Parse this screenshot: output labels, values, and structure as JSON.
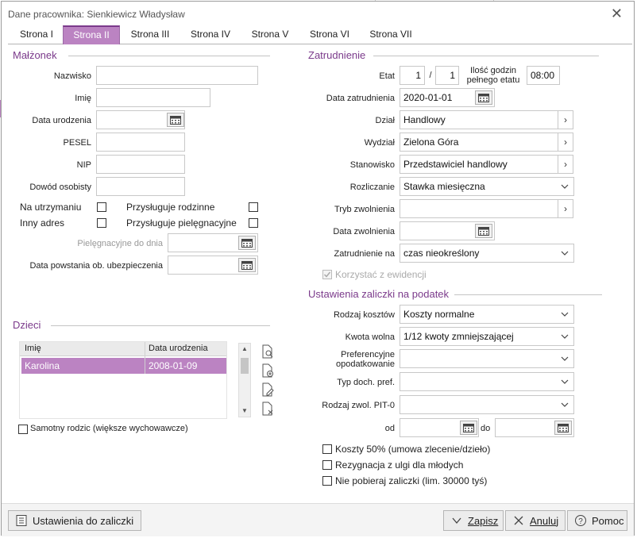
{
  "window": {
    "title": "Dane pracownika: Sienkiewicz Władysław"
  },
  "tabs": [
    "Strona I",
    "Strona II",
    "Strona III",
    "Strona IV",
    "Strona V",
    "Strona VI",
    "Strona VII"
  ],
  "active_tab": "Strona II",
  "malzonek": {
    "section": "Małżonek",
    "labels": {
      "nazwisko": "Nazwisko",
      "imie": "Imię",
      "data_urodzenia": "Data urodzenia",
      "pesel": "PESEL",
      "nip": "NIP",
      "dowod": "Dowód osobisty"
    },
    "values": {
      "nazwisko": "",
      "imie": "",
      "data_urodzenia": "",
      "pesel": "",
      "nip": "",
      "dowod": ""
    },
    "checkboxes": {
      "na_utrzymaniu": "Na utrzymaniu",
      "inny_adres": "Inny adres",
      "rodzinne": "Przysługuje rodzinne",
      "pielegnacyjne": "Przysługuje pielęgnacyjne"
    },
    "pielegnacyjne_do_dnia": "Pielęgnacyjne do dnia",
    "data_powstania": "Data powstania ob. ubezpieczenia"
  },
  "dzieci": {
    "section": "Dzieci",
    "columns": [
      "Imię",
      "Data urodzenia"
    ],
    "rows": [
      {
        "imie": "Karolina",
        "data": "2008-01-09"
      }
    ],
    "samotny": "Samotny rodzic (większe wychowawcze)"
  },
  "zatrudnienie": {
    "section": "Zatrudnienie",
    "etat_label": "Etat",
    "etat_num": "1",
    "etat_sep": "/",
    "etat_den": "1",
    "godziny_label_1": "Ilość godzin",
    "godziny_label_2": "pełnego etatu",
    "godziny_value": "08:00",
    "data_zatrudnienia_label": "Data zatrudnienia",
    "data_zatrudnienia": "2020-01-01",
    "dzial_label": "Dział",
    "dzial": "Handlowy",
    "wydzial_label": "Wydział",
    "wydzial": "Zielona Góra",
    "stanowisko_label": "Stanowisko",
    "stanowisko": "Przedstawiciel handlowy",
    "rozliczanie_label": "Rozliczanie",
    "rozliczanie": "Stawka miesięczna",
    "tryb_label": "Tryb zwolnienia",
    "tryb": "",
    "data_zwolnienia_label": "Data zwolnienia",
    "data_zwolnienia": "",
    "zatrudnienie_na_label": "Zatrudnienie na",
    "zatrudnienie_na": "czas nieokreślony",
    "korzystac": "Korzystać z ewidencji"
  },
  "zaliczki": {
    "section": "Ustawienia zaliczki na podatek",
    "rodzaj_kosztow_label": "Rodzaj kosztów",
    "rodzaj_kosztow": "Koszty normalne",
    "kwota_wolna_label": "Kwota wolna",
    "kwota_wolna": "1/12 kwoty zmniejszającej",
    "pref_label_1": "Preferencyjne",
    "pref_label_2": "opodatkowanie",
    "pref": "",
    "typ_label": "Typ doch. pref.",
    "typ": "",
    "pit0_label": "Rodzaj zwol. PIT-0",
    "pit0": "",
    "od_label": "od",
    "od": "",
    "do_label": "do",
    "do": "",
    "koszty50": "Koszty 50% (umowa zlecenie/dzieło)",
    "rezygnacja": "Rezygnacja z ulgi dla młodych",
    "nie_pobieraj": "Nie pobieraj zaliczki (lim. 30000 tyś)"
  },
  "buttons": {
    "ustawienia": "Ustawienia do zaliczki",
    "zapisz": "Zapisz",
    "anuluj": "Anuluj",
    "pomoc": "Pomoc"
  },
  "colors": {
    "accent": "#bb83c2",
    "accent_dark": "#7b3a8b"
  }
}
